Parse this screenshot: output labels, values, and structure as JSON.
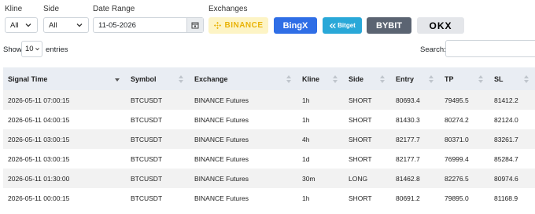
{
  "filters": {
    "kline": {
      "label": "Kline",
      "value": "All"
    },
    "side": {
      "label": "Side",
      "value": "All"
    },
    "date": {
      "label": "Date Range",
      "value": "11-05-2026"
    },
    "exchanges_label": "Exchanges"
  },
  "exchanges": [
    {
      "name": "BINANCE",
      "bg": "#fdf4c5",
      "color": "#e9b308"
    },
    {
      "name": "BingX",
      "bg": "#2f6ee6",
      "color": "#ffffff"
    },
    {
      "name": "Bitget",
      "bg": "#29a8d8",
      "color": "#ffffff"
    },
    {
      "name": "BYBIT",
      "bg": "#5b6472",
      "color": "#ffffff"
    },
    {
      "name": "OKX",
      "bg": "#e4e6ea",
      "color": "#000000"
    }
  ],
  "length": {
    "show": "Show",
    "value": "10",
    "entries": "entries"
  },
  "search": {
    "label": "Search:"
  },
  "table": {
    "headers": [
      "Signal Time",
      "Symbol",
      "Exchange",
      "Kline",
      "Side",
      "Entry",
      "TP",
      "SL"
    ],
    "rows": [
      [
        "2026-05-11 07:00:15",
        "BTCUSDT",
        "BINANCE Futures",
        "1h",
        "SHORT",
        "80693.4",
        "79495.5",
        "81412.2"
      ],
      [
        "2026-05-11 04:00:15",
        "BTCUSDT",
        "BINANCE Futures",
        "1h",
        "SHORT",
        "81430.3",
        "80274.2",
        "82124.0"
      ],
      [
        "2026-05-11 03:00:15",
        "BTCUSDT",
        "BINANCE Futures",
        "4h",
        "SHORT",
        "82177.7",
        "80371.0",
        "83261.7"
      ],
      [
        "2026-05-11 03:00:15",
        "BTCUSDT",
        "BINANCE Futures",
        "1d",
        "SHORT",
        "82177.7",
        "76999.4",
        "85284.7"
      ],
      [
        "2026-05-11 01:30:00",
        "BTCUSDT",
        "BINANCE Futures",
        "30m",
        "LONG",
        "81462.8",
        "82276.5",
        "80974.6"
      ],
      [
        "2026-05-11 00:00:15",
        "BTCUSDT",
        "BINANCE Futures",
        "1h",
        "SHORT",
        "80691.2",
        "79895.0",
        "81168.9"
      ]
    ]
  }
}
